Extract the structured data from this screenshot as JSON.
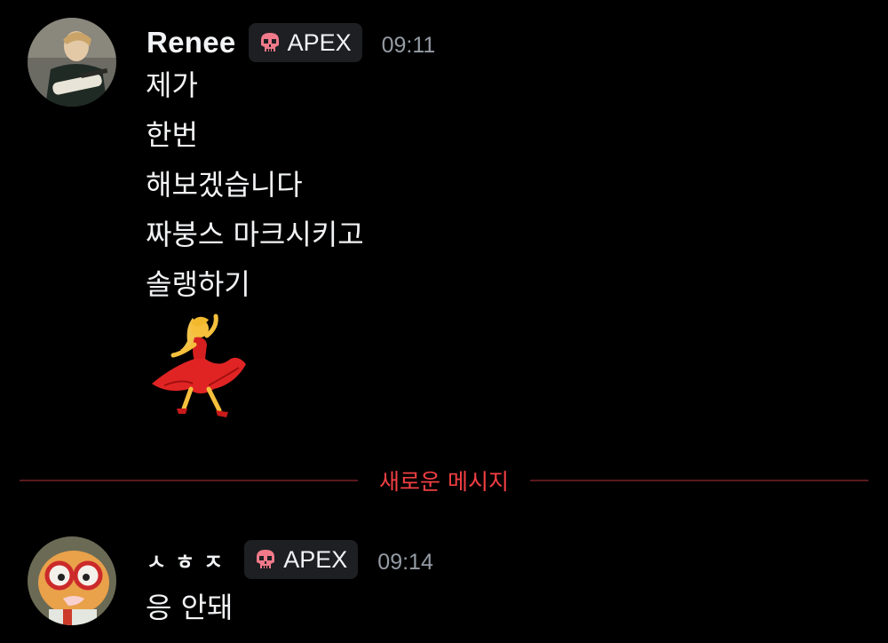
{
  "messages": [
    {
      "username": "Renee",
      "tag": {
        "icon": "skull-icon",
        "label": "APEX"
      },
      "time": "09:11",
      "lines": [
        "제가",
        "한번",
        "해보겠습니다",
        "짜붕스 마크시키고",
        "솔랭하기"
      ],
      "emoji": "woman-dancing-emoji"
    },
    {
      "username": "ㅅㅎㅈ",
      "tag": {
        "icon": "skull-icon",
        "label": "APEX"
      },
      "time": "09:14",
      "lines": [
        "응 안돼"
      ]
    }
  ],
  "divider": {
    "label": "새로운 메시지"
  },
  "colors": {
    "background": "#000000",
    "text": "#f2f3f5",
    "muted": "#949ba4",
    "tag_bg": "#1e1f22",
    "new_message_red": "#f23f43",
    "skull_pink": "#f07a8a"
  }
}
